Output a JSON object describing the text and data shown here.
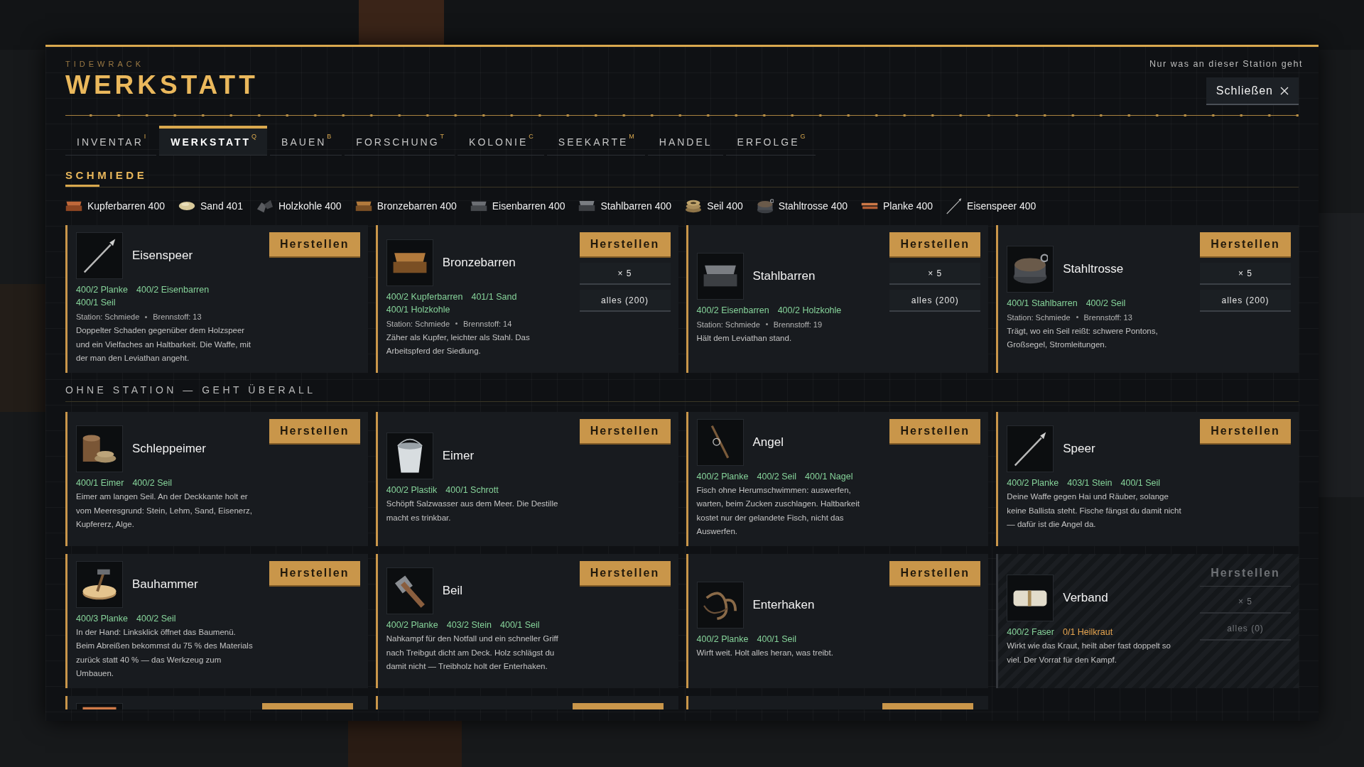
{
  "brand": "TIDEWRACK",
  "title": "WERKSTATT",
  "note": "Nur was an dieser Station geht",
  "close_button": "Schließen",
  "tabs": [
    {
      "label": "INVENTAR",
      "hotkey": "I",
      "selected": false
    },
    {
      "label": "WERKSTATT",
      "hotkey": "Q",
      "selected": true
    },
    {
      "label": "BAUEN",
      "hotkey": "B",
      "selected": false
    },
    {
      "label": "FORSCHUNG",
      "hotkey": "T",
      "selected": false
    },
    {
      "label": "KOLONIE",
      "hotkey": "C",
      "selected": false
    },
    {
      "label": "SEEKARTE",
      "hotkey": "M",
      "selected": false
    },
    {
      "label": "HANDEL",
      "selected": false
    },
    {
      "label": "ERFOLGE",
      "hotkey": "G",
      "selected": false
    }
  ],
  "sections": [
    {
      "title": "SCHMIEDE",
      "resources": [
        {
          "kind": "copper-ingot",
          "label": "Kupferbarren 400"
        },
        {
          "kind": "pebble",
          "label": "Sand 401"
        },
        {
          "kind": "coal",
          "label": "Holzkohle 400"
        },
        {
          "kind": "bronze-ingot",
          "label": "Bronzebarren 400"
        },
        {
          "kind": "iron-ingot",
          "label": "Eisenbarren 400"
        },
        {
          "kind": "steel-ingot",
          "label": "Stahlbarren 400"
        },
        {
          "kind": "rope",
          "label": "Seil 400"
        },
        {
          "kind": "cable",
          "label": "Stahltrosse 400"
        },
        {
          "kind": "plank",
          "label": "Planke 400"
        },
        {
          "kind": "spear",
          "label": "Eisenspeer 400"
        }
      ],
      "cards": [
        {
          "kind": "spear",
          "name": "Eisenspeer",
          "requirements": [
            {
              "text": "400/2 Planke",
              "ok": true
            },
            {
              "text": "400/2 Eisenbarren",
              "ok": true
            },
            {
              "text": "400/1 Seil",
              "ok": true
            }
          ],
          "station": "Station: Schmiede",
          "fuel": "Brennstoff: 13",
          "description": "Doppelter Schaden gegenüber dem Holzspeer und ein Vielfaches an Haltbarkeit. Die Waffe, mit der man den Leviathan angeht.",
          "button": "Herstellen",
          "available": true
        },
        {
          "kind": "bronze-ingot",
          "name": "Bronzebarren",
          "requirements": [
            {
              "text": "400/2 Kupferbarren",
              "ok": true
            },
            {
              "text": "401/1 Sand",
              "ok": true
            },
            {
              "text": "400/1 Holzkohle",
              "ok": true
            }
          ],
          "station": "Station: Schmiede",
          "fuel": "Brennstoff: 14",
          "description": "Zäher als Kupfer, leichter als Stahl. Das Arbeitspferd der Siedlung.",
          "button": "Herstellen",
          "batch": [
            "× 5",
            "alles (200)"
          ],
          "available": true
        },
        {
          "kind": "steel-ingot",
          "name": "Stahlbarren",
          "requirements": [
            {
              "text": "400/2 Eisenbarren",
              "ok": true
            },
            {
              "text": "400/2 Holzkohle",
              "ok": true
            }
          ],
          "station": "Station: Schmiede",
          "fuel": "Brennstoff: 19",
          "description": "Hält dem Leviathan stand.",
          "button": "Herstellen",
          "batch": [
            "× 5",
            "alles (200)"
          ],
          "available": true
        },
        {
          "kind": "cable",
          "name": "Stahltrosse",
          "requirements": [
            {
              "text": "400/1 Stahlbarren",
              "ok": true
            },
            {
              "text": "400/2 Seil",
              "ok": true
            }
          ],
          "station": "Station: Schmiede",
          "fuel": "Brennstoff: 13",
          "description": "Trägt, wo ein Seil reißt: schwere Pontons, Großsegel, Stromleitungen.",
          "button": "Herstellen",
          "batch": [
            "× 5",
            "alles (200)"
          ],
          "available": true
        }
      ]
    },
    {
      "title": "OHNE STATION — GEHT ÜBERALL",
      "cards": [
        {
          "kind": "rope-bucket",
          "name": "Schleppeimer",
          "requirements": [
            {
              "text": "400/1 Eimer",
              "ok": true
            },
            {
              "text": "400/2 Seil",
              "ok": true
            }
          ],
          "description": "Eimer am langen Seil. An der Deckkante holt er vom Meeresgrund: Stein, Lehm, Sand, Eisenerz, Kupfererz, Alge.",
          "button": "Herstellen",
          "available": true
        },
        {
          "kind": "bucket",
          "name": "Eimer",
          "requirements": [
            {
              "text": "400/2 Plastik",
              "ok": true
            },
            {
              "text": "400/1 Schrott",
              "ok": true
            }
          ],
          "description": "Schöpft Salzwasser aus dem Meer. Die Destille macht es trinkbar.",
          "button": "Herstellen",
          "available": true
        },
        {
          "kind": "rod",
          "name": "Angel",
          "requirements": [
            {
              "text": "400/2 Planke",
              "ok": true
            },
            {
              "text": "400/2 Seil",
              "ok": true
            },
            {
              "text": "400/1 Nagel",
              "ok": true
            }
          ],
          "description": "Fisch ohne Herumschwimmen: auswerfen, warten, beim Zucken zuschlagen. Haltbarkeit kostet nur der gelandete Fisch, nicht das Auswerfen.",
          "button": "Herstellen",
          "available": true
        },
        {
          "kind": "spear",
          "name": "Speer",
          "requirements": [
            {
              "text": "400/2 Planke",
              "ok": true
            },
            {
              "text": "403/1 Stein",
              "ok": true
            },
            {
              "text": "400/1 Seil",
              "ok": true
            }
          ],
          "description": "Deine Waffe gegen Hai und Räuber, solange keine Ballista steht. Fische fängst du damit nicht — dafür ist die Angel da.",
          "button": "Herstellen",
          "available": true
        },
        {
          "kind": "hammer",
          "name": "Bauhammer",
          "requirements": [
            {
              "text": "400/3 Planke",
              "ok": true
            },
            {
              "text": "400/2 Seil",
              "ok": true
            }
          ],
          "description": "In der Hand: Linksklick öffnet das Baumenü. Beim Abreißen bekommst du 75 % des Materials zurück statt 40 % — das Werkzeug zum Umbauen.",
          "button": "Herstellen",
          "available": true
        },
        {
          "kind": "axe",
          "name": "Beil",
          "requirements": [
            {
              "text": "400/2 Planke",
              "ok": true
            },
            {
              "text": "403/2 Stein",
              "ok": true
            },
            {
              "text": "400/1 Seil",
              "ok": true
            }
          ],
          "description": "Nahkampf für den Notfall und ein schneller Griff nach Treibgut dicht am Deck. Holz schlägst du damit nicht — Treibholz holt der Enterhaken.",
          "button": "Herstellen",
          "available": true
        },
        {
          "kind": "hook",
          "name": "Enterhaken",
          "requirements": [
            {
              "text": "400/2 Planke",
              "ok": true
            },
            {
              "text": "400/1 Seil",
              "ok": true
            }
          ],
          "description": "Wirft weit. Holt alles heran, was treibt.",
          "button": "Herstellen",
          "available": true
        },
        {
          "kind": "bandage",
          "name": "Verband",
          "requirements": [
            {
              "text": "400/2 Faser",
              "ok": true
            },
            {
              "text": "0/1 Heilkraut",
              "ok": false
            }
          ],
          "description": "Wirkt wie das Kraut, heilt aber fast doppelt so viel. Der Vorrat für den Kampf.",
          "button": "Herstellen",
          "batch": [
            "× 5",
            "alles (0)"
          ],
          "available": false
        }
      ],
      "partial_cards": [
        {
          "has_icon": true
        },
        {
          "has_icon": false
        },
        {
          "has_icon": false
        }
      ]
    }
  ]
}
